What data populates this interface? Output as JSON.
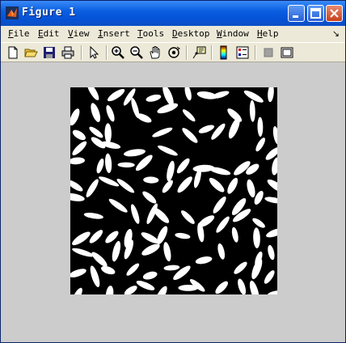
{
  "window": {
    "title": "Figure 1"
  },
  "menubar": {
    "items": [
      {
        "mnemonic": "F",
        "rest": "ile"
      },
      {
        "mnemonic": "E",
        "rest": "dit"
      },
      {
        "mnemonic": "V",
        "rest": "iew"
      },
      {
        "mnemonic": "I",
        "rest": "nsert"
      },
      {
        "mnemonic": "T",
        "rest": "ools"
      },
      {
        "mnemonic": "D",
        "rest": "esktop"
      },
      {
        "mnemonic": "W",
        "rest": "indow"
      },
      {
        "mnemonic": "H",
        "rest": "elp"
      }
    ],
    "overflow_icon": "dock-arrow-icon"
  },
  "toolbar": {
    "icons": [
      "new-figure-icon",
      "open-file-icon",
      "save-icon",
      "print-icon",
      "select-arrow-icon",
      "zoom-in-icon",
      "zoom-out-icon",
      "pan-hand-icon",
      "rotate-3d-icon",
      "data-cursor-icon",
      "colorbar-icon",
      "legend-icon",
      "hide-plot-tools-icon",
      "show-plot-tools-icon"
    ]
  },
  "figure": {
    "content": "binary image of white rice grains on black background",
    "colors": {
      "background": "#000000",
      "foreground": "#ffffff"
    }
  },
  "colors": {
    "titlebar": "#0553d8",
    "chrome": "#ece9d8",
    "figure_bg": "#cccccc"
  }
}
